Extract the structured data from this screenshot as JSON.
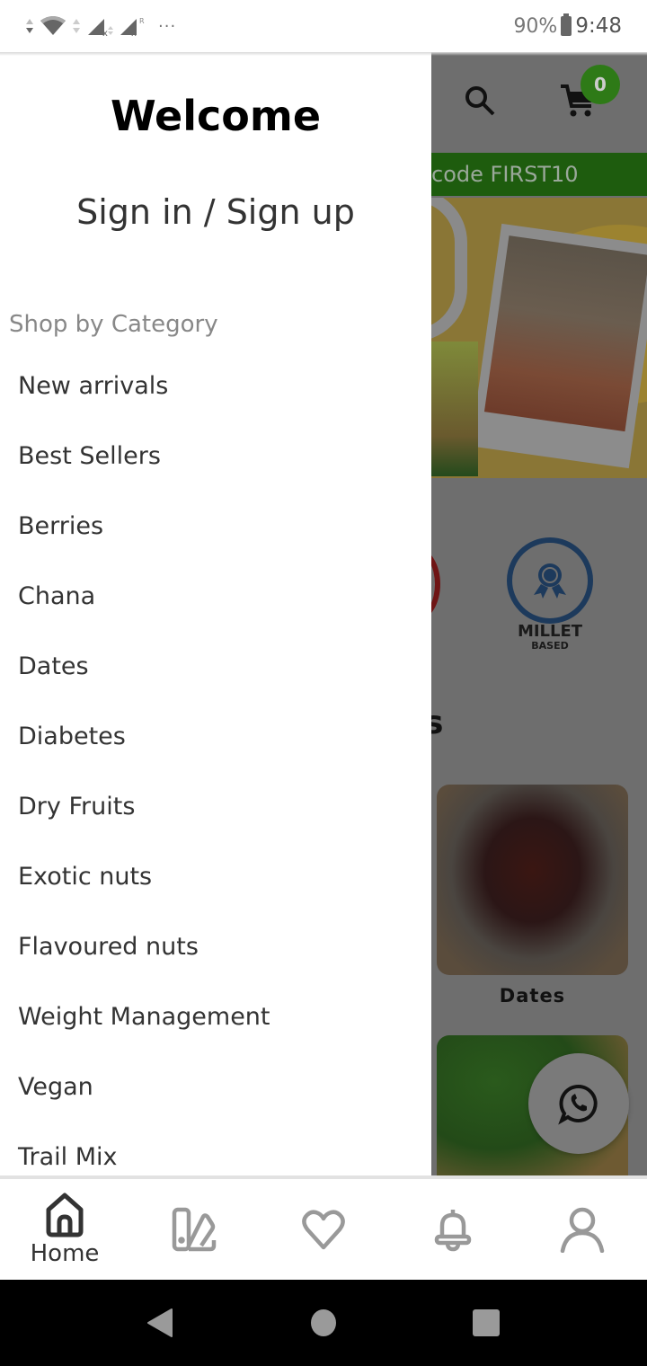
{
  "status_bar": {
    "battery_percent": "90%",
    "time": "9:48",
    "overflow": "···"
  },
  "background_app": {
    "cart_count": "0",
    "promo_text": "code FIRST10",
    "badge_millet_title": "MILLET",
    "badge_millet_sub": "BASED",
    "heading_fragment": "s",
    "card_dates_label": "Dates",
    "colors": {
      "brand_green": "#2e7a17",
      "promo_green": "#1e5c0e"
    }
  },
  "drawer": {
    "title": "Welcome",
    "sign_in_link": "Sign in / Sign up",
    "section_label": "Shop by Category",
    "categories": [
      {
        "label": "New arrivals"
      },
      {
        "label": "Best Sellers"
      },
      {
        "label": "Berries"
      },
      {
        "label": "Chana"
      },
      {
        "label": "Dates"
      },
      {
        "label": "Diabetes"
      },
      {
        "label": "Dry Fruits"
      },
      {
        "label": "Exotic nuts"
      },
      {
        "label": "Flavoured nuts"
      },
      {
        "label": "Weight Management"
      },
      {
        "label": "Vegan"
      },
      {
        "label": "Trail Mix"
      }
    ]
  },
  "bottom_nav": {
    "items": [
      {
        "icon": "home-icon",
        "label": "Home",
        "active": true
      },
      {
        "icon": "catalog-icon",
        "label": "",
        "active": false
      },
      {
        "icon": "heart-icon",
        "label": "",
        "active": false
      },
      {
        "icon": "bell-icon",
        "label": "",
        "active": false
      },
      {
        "icon": "user-icon",
        "label": "",
        "active": false
      }
    ]
  }
}
